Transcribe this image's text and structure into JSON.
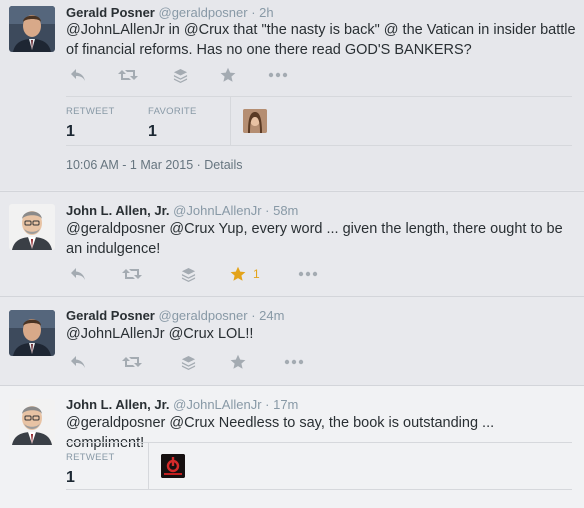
{
  "tweets": [
    {
      "name": "Gerald Posner",
      "handle": "@geraldposner",
      "time": "· 2h",
      "text": "@JohnLAllenJr in @Crux that \"the nasty is back\" @ the Vatican in insider battle of financial reforms.  Has no one there read GOD'S BANKERS?",
      "stats": {
        "retweet_label": "RETWEET",
        "retweet_count": "1",
        "favorite_label": "FAVORITE",
        "favorite_count": "1"
      },
      "timestamp": "10:06 AM - 1 Mar 2015 · Details"
    },
    {
      "name": "John L. Allen, Jr.",
      "handle": "@JohnLAllenJr",
      "time": "· 58m",
      "text": "@geraldposner @Crux Yup, every word ... given the length, there ought to be an indulgence!",
      "favorite_count": "1"
    },
    {
      "name": "Gerald Posner",
      "handle": "@geraldposner",
      "time": "· 24m",
      "text": "@JohnLAllenJr @Crux LOL!!"
    },
    {
      "name": "John L. Allen, Jr.",
      "handle": "@JohnLAllenJr",
      "time": "· 17m",
      "text": "@geraldposner @Crux Needless to say, the book is outstanding ... compliment!",
      "stats": {
        "retweet_label": "RETWEET",
        "retweet_count": "1"
      }
    }
  ],
  "icons": {
    "reply": "reply-icon",
    "retweet": "retweet-icon",
    "stack": "stack-icon",
    "favorite": "star-icon",
    "more": "more-icon"
  },
  "colors": {
    "favorite_active": "#e3a31a",
    "icon_gray": "#a4abb2",
    "handle_gray": "#8899a6"
  }
}
